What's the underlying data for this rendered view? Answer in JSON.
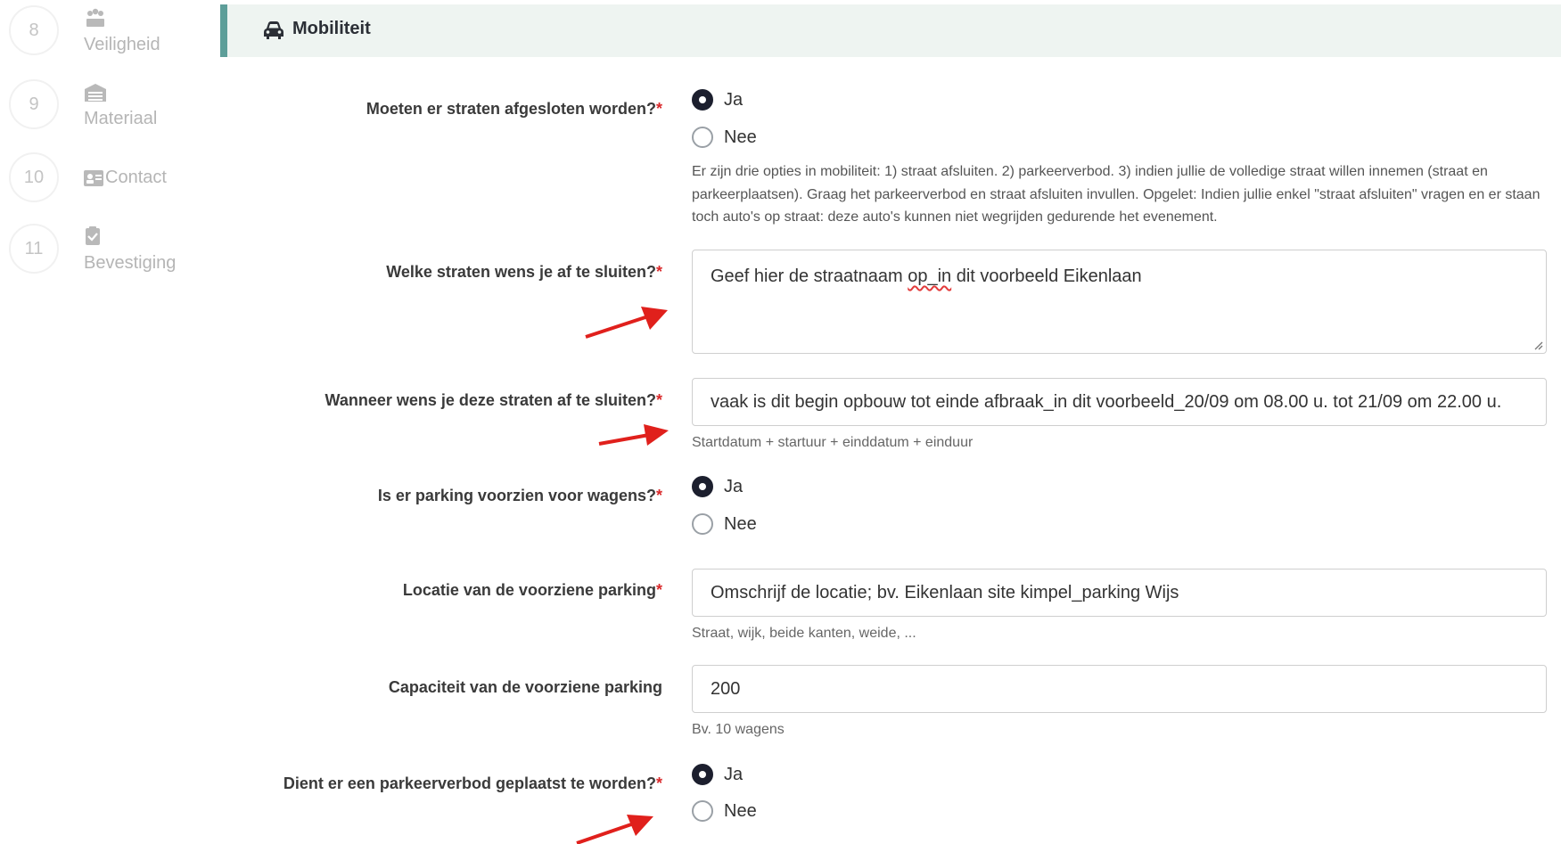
{
  "sidebar": {
    "steps": [
      {
        "number": "8",
        "label": "Veiligheid",
        "icon": "users-icon"
      },
      {
        "number": "9",
        "label": "Materiaal",
        "icon": "warehouse-icon"
      },
      {
        "number": "10",
        "label": "Contact",
        "icon": "id-card-icon"
      },
      {
        "number": "11",
        "label": "Bevestiging",
        "icon": "clipboard-check-icon"
      }
    ]
  },
  "section": {
    "title": "Mobiliteit",
    "icon": "car-icon"
  },
  "form": {
    "q1": {
      "label": "Moeten er straten afgesloten worden?",
      "required_mark": "*",
      "options": [
        "Ja",
        "Nee"
      ],
      "selected": "Ja",
      "help": "Er zijn drie opties in mobiliteit: 1) straat afsluiten. 2) parkeerverbod. 3) indien jullie de volledige straat willen innemen (straat en parkeerplaatsen). Graag het parkeerverbod en straat afsluiten invullen. Opgelet: Indien jullie enkel \"straat afsluiten\" vragen en er staan toch auto's op straat: deze auto's kunnen niet wegrijden gedurende het evenement."
    },
    "q2": {
      "label": "Welke straten wens je af te sluiten?",
      "required_mark": "*",
      "value_before": "Geef hier de straatnaam ",
      "value_flagged": "op_in",
      "value_after": " dit voorbeeld Eikenlaan"
    },
    "q3": {
      "label": "Wanneer wens je deze straten af te sluiten?",
      "required_mark": "*",
      "value": "vaak is dit begin opbouw tot einde afbraak_in dit voorbeeld_20/09 om 08.00 u. tot 21/09 om 22.00 u.",
      "hint": "Startdatum + startuur + einddatum + einduur"
    },
    "q4": {
      "label": "Is er parking voorzien voor wagens?",
      "required_mark": "*",
      "options": [
        "Ja",
        "Nee"
      ],
      "selected": "Ja"
    },
    "q5": {
      "label": "Locatie van de voorziene parking",
      "required_mark": "*",
      "value": "Omschrijf de locatie; bv. Eikenlaan site kimpel_parking Wijs",
      "hint": "Straat, wijk, beide kanten, weide, ..."
    },
    "q6": {
      "label": "Capaciteit van de voorziene parking",
      "value": "200",
      "hint": "Bv. 10 wagens"
    },
    "q7": {
      "label": "Dient er een parkeerverbod geplaatst te worden?",
      "required_mark": "*",
      "options": [
        "Ja",
        "Nee"
      ],
      "selected": "Ja"
    }
  },
  "colors": {
    "accent": "#5d9e99",
    "header_bg": "#eef4f1",
    "required": "#d9292b",
    "radio_checked": "#1c1f2e",
    "annotation_arrow": "#e0201c"
  }
}
